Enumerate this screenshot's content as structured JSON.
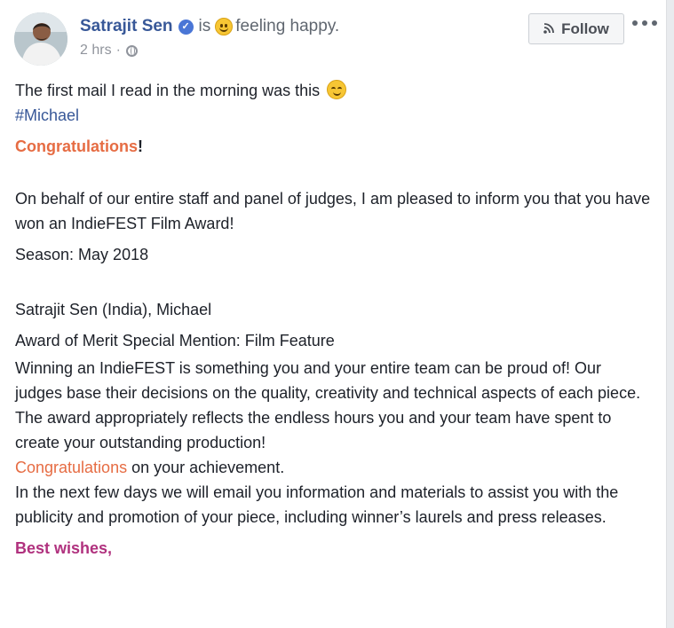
{
  "header": {
    "author": "Satrajit Sen",
    "verified_mark": "✓",
    "is_text": "is",
    "feeling_icon": "smiley-icon",
    "feeling_text": "feeling happy.",
    "time": "2 hrs",
    "separator": "·",
    "privacy_icon": "globe-icon",
    "follow_label": "Follow",
    "follow_icon": "rss-icon",
    "more_icon": "more-options-icon"
  },
  "post": {
    "line1": "The first mail I read in the morning was this",
    "line1_icon": "blushing-smiley-icon",
    "hashtag": "#Michael",
    "congrats_word": "Congratulations",
    "congrats_mark": "!",
    "para1": "On behalf of our entire staff and panel of judges, I am pleased to inform you that you have won an IndieFEST Film Award!",
    "season": "Season: May 2018",
    "recipient": "Satrajit Sen (India), Michael",
    "award": "Award of Merit Special Mention: Film Feature",
    "para2": "Winning an IndieFEST is something you and your entire team can be proud of! Our judges base their decisions on the quality, creativity and technical aspects of each piece. The award appropriately reflects the endless hours you and your team have spent to create your outstanding production!",
    "congrats2_word": "Congratulations",
    "congrats2_rest": " on your achievement.",
    "para3": "In the next few days we will email you information and materials to assist you with the publicity and promotion of your piece, including winner’s laurels and press releases.",
    "sign_off": "Best wishes",
    "sign_off_mark": ","
  },
  "colors": {
    "author_link": "#385898",
    "accent_orange": "#e66c43",
    "accent_purple": "#b0317e",
    "meta_gray": "#90949c"
  }
}
